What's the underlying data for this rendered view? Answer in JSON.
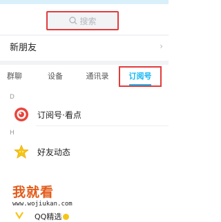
{
  "search": {
    "placeholder": "搜索",
    "icon": "search-icon"
  },
  "new_friends": {
    "label": "新朋友",
    "chevron": "›"
  },
  "tabs": [
    {
      "label": "群聊"
    },
    {
      "label": "设备"
    },
    {
      "label": "通讯录"
    },
    {
      "label": "订阅号",
      "selected": true
    }
  ],
  "sections": [
    {
      "letter": "D",
      "items": [
        {
          "label": "订阅号·看点",
          "icon": "kandian-icon"
        }
      ]
    },
    {
      "letter": "H",
      "items": [
        {
          "label": "好友动态",
          "icon": "star-icon"
        }
      ]
    }
  ],
  "partial_item": {
    "label": "QQ精选",
    "icon": "qq-jingxuan-icon"
  },
  "watermark": {
    "title": "我就看",
    "url": "www.wojiukan.com"
  },
  "colors": {
    "accent": "#12b7f5",
    "highlight": "#e23a3a",
    "kandian": "#e8453c",
    "star": "#f5c518"
  }
}
